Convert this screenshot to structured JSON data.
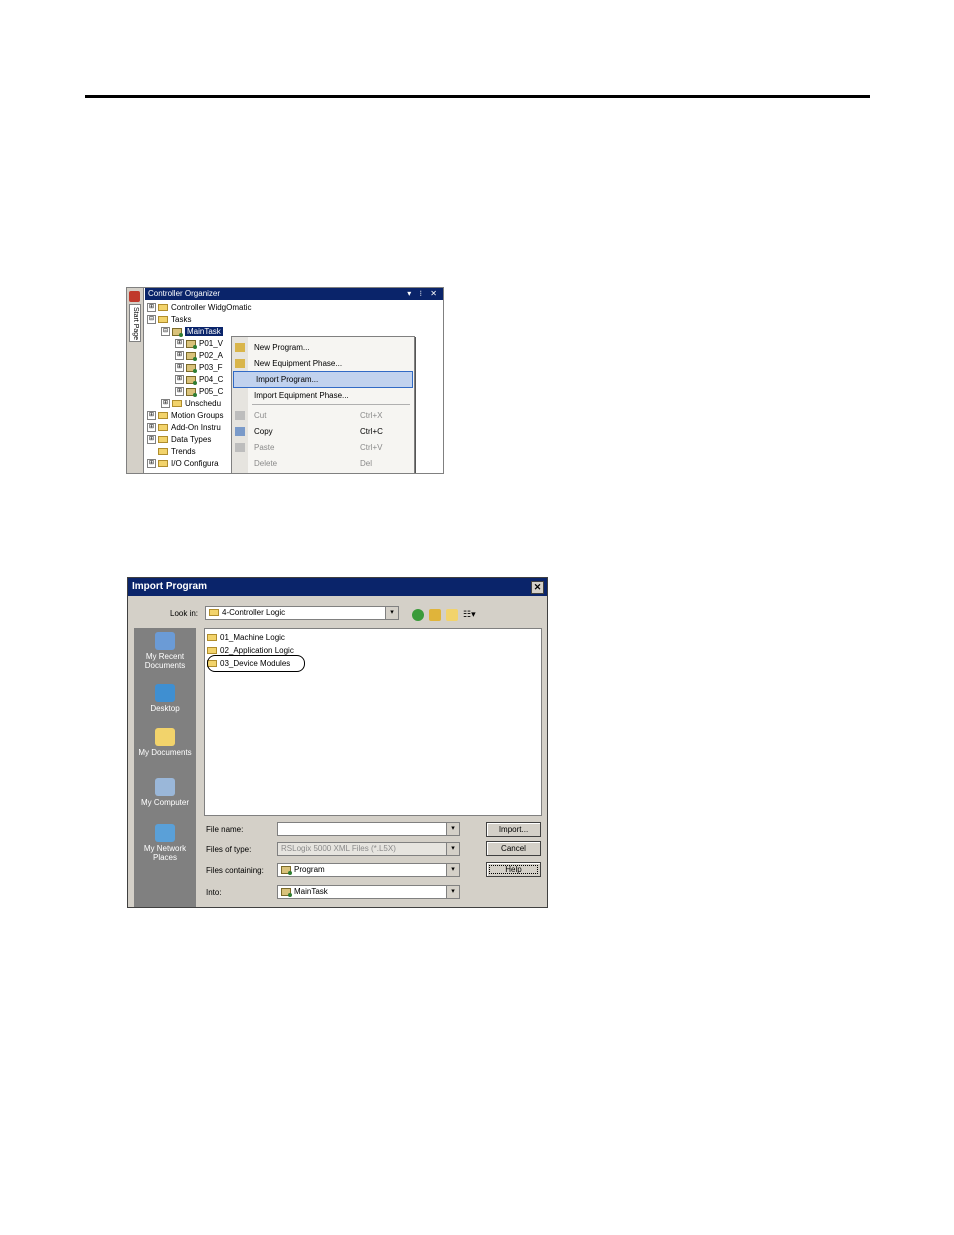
{
  "organizer": {
    "title": "Controller Organizer",
    "window_controls": "▾ ⁝ ✕",
    "side_tab": "Start Page",
    "tree": [
      {
        "label": "Controller WidgOmatic",
        "expander": "⊞",
        "icon": "folder-icon"
      },
      {
        "label": "Tasks",
        "expander": "⊟",
        "icon": "folder-icon"
      },
      {
        "label": "MainTask",
        "expander": "⊟",
        "icon": "task-icon",
        "selected": true
      },
      {
        "label": "P01_V",
        "expander": "⊞",
        "icon": "program-icon"
      },
      {
        "label": "P02_A",
        "expander": "⊞",
        "icon": "program-icon"
      },
      {
        "label": "P03_F",
        "expander": "⊞",
        "icon": "program-icon"
      },
      {
        "label": "P04_C",
        "expander": "⊞",
        "icon": "program-icon"
      },
      {
        "label": "P05_C",
        "expander": "⊞",
        "icon": "program-icon"
      },
      {
        "label": "Unschedu",
        "expander": "⊞",
        "icon": "folder-icon"
      },
      {
        "label": "Motion Groups",
        "expander": "⊞",
        "icon": "folder-icon"
      },
      {
        "label": "Add-On Instru",
        "expander": "⊞",
        "icon": "folder-icon"
      },
      {
        "label": "Data Types",
        "expander": "⊞",
        "icon": "folder-icon"
      },
      {
        "label": "Trends",
        "expander": "",
        "icon": "folder-icon"
      },
      {
        "label": "I/O Configura",
        "expander": "⊞",
        "icon": "folder-icon"
      }
    ],
    "context_menu": [
      {
        "label": "New Program...",
        "shortcut": "",
        "disabled": false,
        "highlight": false
      },
      {
        "label": "New Equipment Phase...",
        "shortcut": "",
        "disabled": false,
        "highlight": false
      },
      {
        "label": "Import Program...",
        "shortcut": "",
        "disabled": false,
        "highlight": true
      },
      {
        "label": "Import Equipment Phase...",
        "shortcut": "",
        "disabled": false,
        "highlight": false
      },
      {
        "label": "Cut",
        "shortcut": "Ctrl+X",
        "disabled": true,
        "highlight": false
      },
      {
        "label": "Copy",
        "shortcut": "Ctrl+C",
        "disabled": false,
        "highlight": false
      },
      {
        "label": "Paste",
        "shortcut": "Ctrl+V",
        "disabled": true,
        "highlight": false
      },
      {
        "label": "Delete",
        "shortcut": "Del",
        "disabled": true,
        "highlight": false
      }
    ]
  },
  "dialog": {
    "title": "Import Program",
    "close": "✕",
    "look_in_label": "Look in:",
    "look_in_value": "4-Controller Logic",
    "places": [
      "My Recent Documents",
      "Desktop",
      "My Documents",
      "My Computer",
      "My Network Places"
    ],
    "files": [
      "01_Machine Logic",
      "02_Application Logic",
      "03_Device Modules"
    ],
    "fields": {
      "file_name_label": "File name:",
      "file_name_value": "",
      "files_of_type_label": "Files of type:",
      "files_of_type_value": "RSLogix 5000 XML Files (*.L5X)",
      "files_containing_label": "Files containing:",
      "files_containing_value": "Program",
      "into_label": "Into:",
      "into_value": "MainTask"
    },
    "buttons": {
      "import": "Import...",
      "cancel": "Cancel",
      "help": "Help"
    },
    "arrow": "▾",
    "view_menu": "☷▾"
  }
}
